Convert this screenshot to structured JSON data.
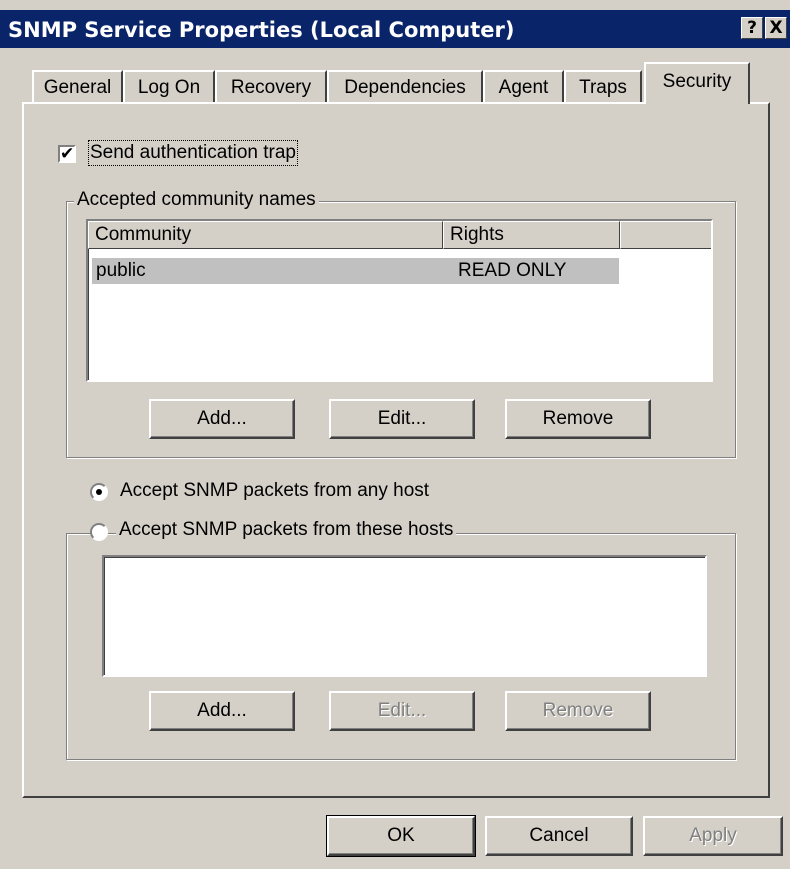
{
  "window": {
    "title": "SNMP Service Properties (Local Computer)",
    "help_button": "?",
    "close_button": "X"
  },
  "tabs": [
    {
      "label": "General",
      "active": false
    },
    {
      "label": "Log On",
      "active": false
    },
    {
      "label": "Recovery",
      "active": false
    },
    {
      "label": "Dependencies",
      "active": false
    },
    {
      "label": "Agent",
      "active": false
    },
    {
      "label": "Traps",
      "active": false
    },
    {
      "label": "Security",
      "active": true
    }
  ],
  "security": {
    "send_auth_trap": {
      "label": "Send authentication trap",
      "checked": true
    },
    "community_group": {
      "title": "Accepted community names",
      "columns": [
        "Community",
        "Rights"
      ],
      "rows": [
        {
          "community": "public",
          "rights": "READ ONLY",
          "selected": true
        }
      ],
      "buttons": {
        "add": "Add...",
        "edit": "Edit...",
        "remove": "Remove"
      }
    },
    "accept_any_host": {
      "label": "Accept SNMP packets from any host",
      "selected": true
    },
    "accept_these_hosts": {
      "label": "Accept SNMP packets from these hosts",
      "selected": false,
      "hosts": [],
      "buttons": {
        "add": "Add...",
        "edit": "Edit...",
        "remove": "Remove"
      },
      "edit_disabled": true,
      "remove_disabled": true
    }
  },
  "footer": {
    "ok": "OK",
    "cancel": "Cancel",
    "apply": "Apply",
    "apply_disabled": true
  },
  "colors": {
    "title_bar": "#0a246a",
    "dialog_face": "#d4d0c8",
    "selected_row": "#c0c0c0"
  }
}
